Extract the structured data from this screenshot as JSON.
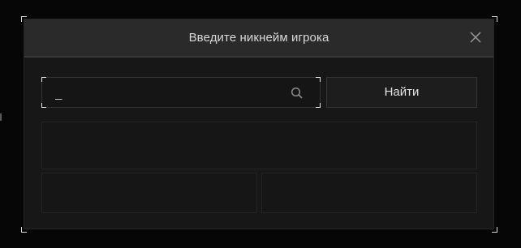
{
  "dialog": {
    "title": "Введите никнейм игрока",
    "close_icon": "close-icon"
  },
  "search": {
    "value": "_",
    "icon": "search-icon"
  },
  "find_button": {
    "label": "Найти"
  },
  "results": {
    "slots": 3
  },
  "colors": {
    "background": "#060606",
    "modal": "#171717",
    "header": "#2a2a2a",
    "text": "#d9d9d9",
    "border": "#343434",
    "corner_accent": "#d8d8d8"
  }
}
